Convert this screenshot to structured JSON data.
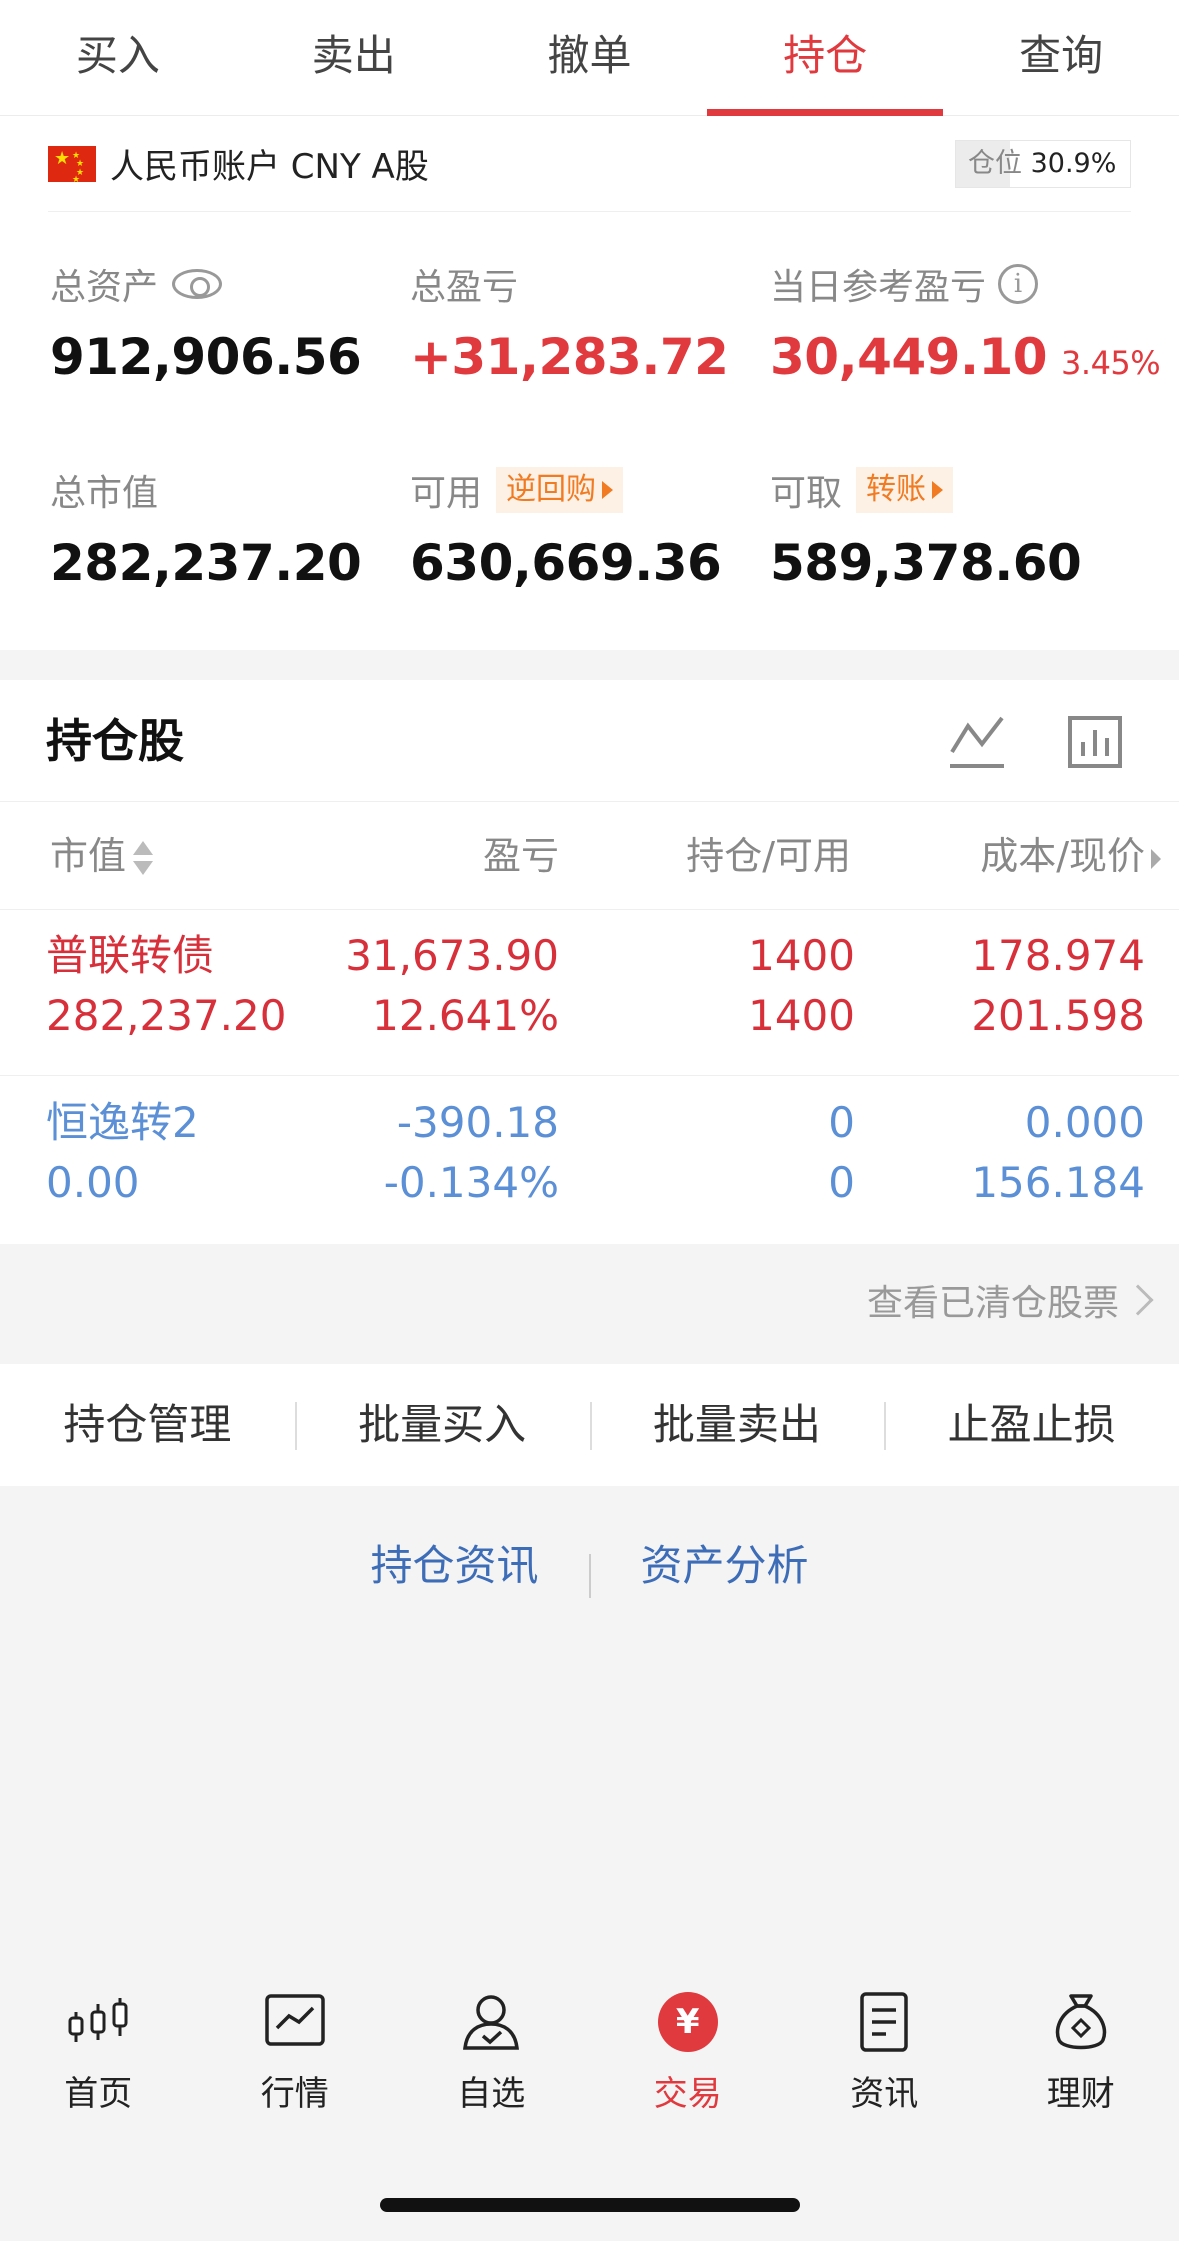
{
  "tabs": [
    {
      "label": "买入"
    },
    {
      "label": "卖出"
    },
    {
      "label": "撤单"
    },
    {
      "label": "持仓",
      "active": true
    },
    {
      "label": "查询"
    }
  ],
  "account": {
    "name": "人民币账户 CNY A股",
    "position_label": "仓位",
    "position_value": "30.9%",
    "position_fraction": 0.309
  },
  "stats": {
    "total_assets": {
      "label": "总资产",
      "value": "912,906.56"
    },
    "total_pnl": {
      "label": "总盈亏",
      "value": "+31,283.72"
    },
    "daily_pnl": {
      "label": "当日参考盈亏",
      "value": "30,449.10",
      "pct": "3.45%"
    },
    "market_value": {
      "label": "总市值",
      "value": "282,237.20"
    },
    "available": {
      "label": "可用",
      "tag": "逆回购",
      "value": "630,669.36"
    },
    "withdrawable": {
      "label": "可取",
      "tag": "转账",
      "value": "589,378.60"
    }
  },
  "holdings": {
    "title": "持仓股",
    "columns": {
      "market_value": "市值",
      "pnl": "盈亏",
      "position": "持仓/可用",
      "cost": "成本/现价"
    },
    "rows": [
      {
        "name": "普联转债",
        "market_value": "282,237.20",
        "pnl": "31,673.90",
        "pnl_pct": "12.641%",
        "hold": "1400",
        "available": "1400",
        "cost": "178.974",
        "price": "201.598",
        "color": "#d8303a"
      },
      {
        "name": "恒逸转2",
        "market_value": "0.00",
        "pnl": "-390.18",
        "pnl_pct": "-0.134%",
        "hold": "0",
        "available": "0",
        "cost": "0.000",
        "price": "156.184",
        "color": "#5b8fd6"
      }
    ]
  },
  "cleared_link": "查看已清仓股票",
  "actions": [
    {
      "label": "持仓管理"
    },
    {
      "label": "批量买入"
    },
    {
      "label": "批量卖出"
    },
    {
      "label": "止盈止损"
    }
  ],
  "links": [
    {
      "label": "持仓资讯"
    },
    {
      "label": "资产分析"
    }
  ],
  "nav": [
    {
      "label": "首页",
      "icon": "candlestick-icon"
    },
    {
      "label": "行情",
      "icon": "market-chart-icon"
    },
    {
      "label": "自选",
      "icon": "user-check-icon"
    },
    {
      "label": "交易",
      "icon": "yen-icon",
      "active": true
    },
    {
      "label": "资讯",
      "icon": "document-icon"
    },
    {
      "label": "理财",
      "icon": "money-bag-icon"
    }
  ],
  "colors": {
    "accent": "#e0393e",
    "loss": "#5b8fd6",
    "link": "#3e6db8",
    "tag": "#f07b22"
  }
}
